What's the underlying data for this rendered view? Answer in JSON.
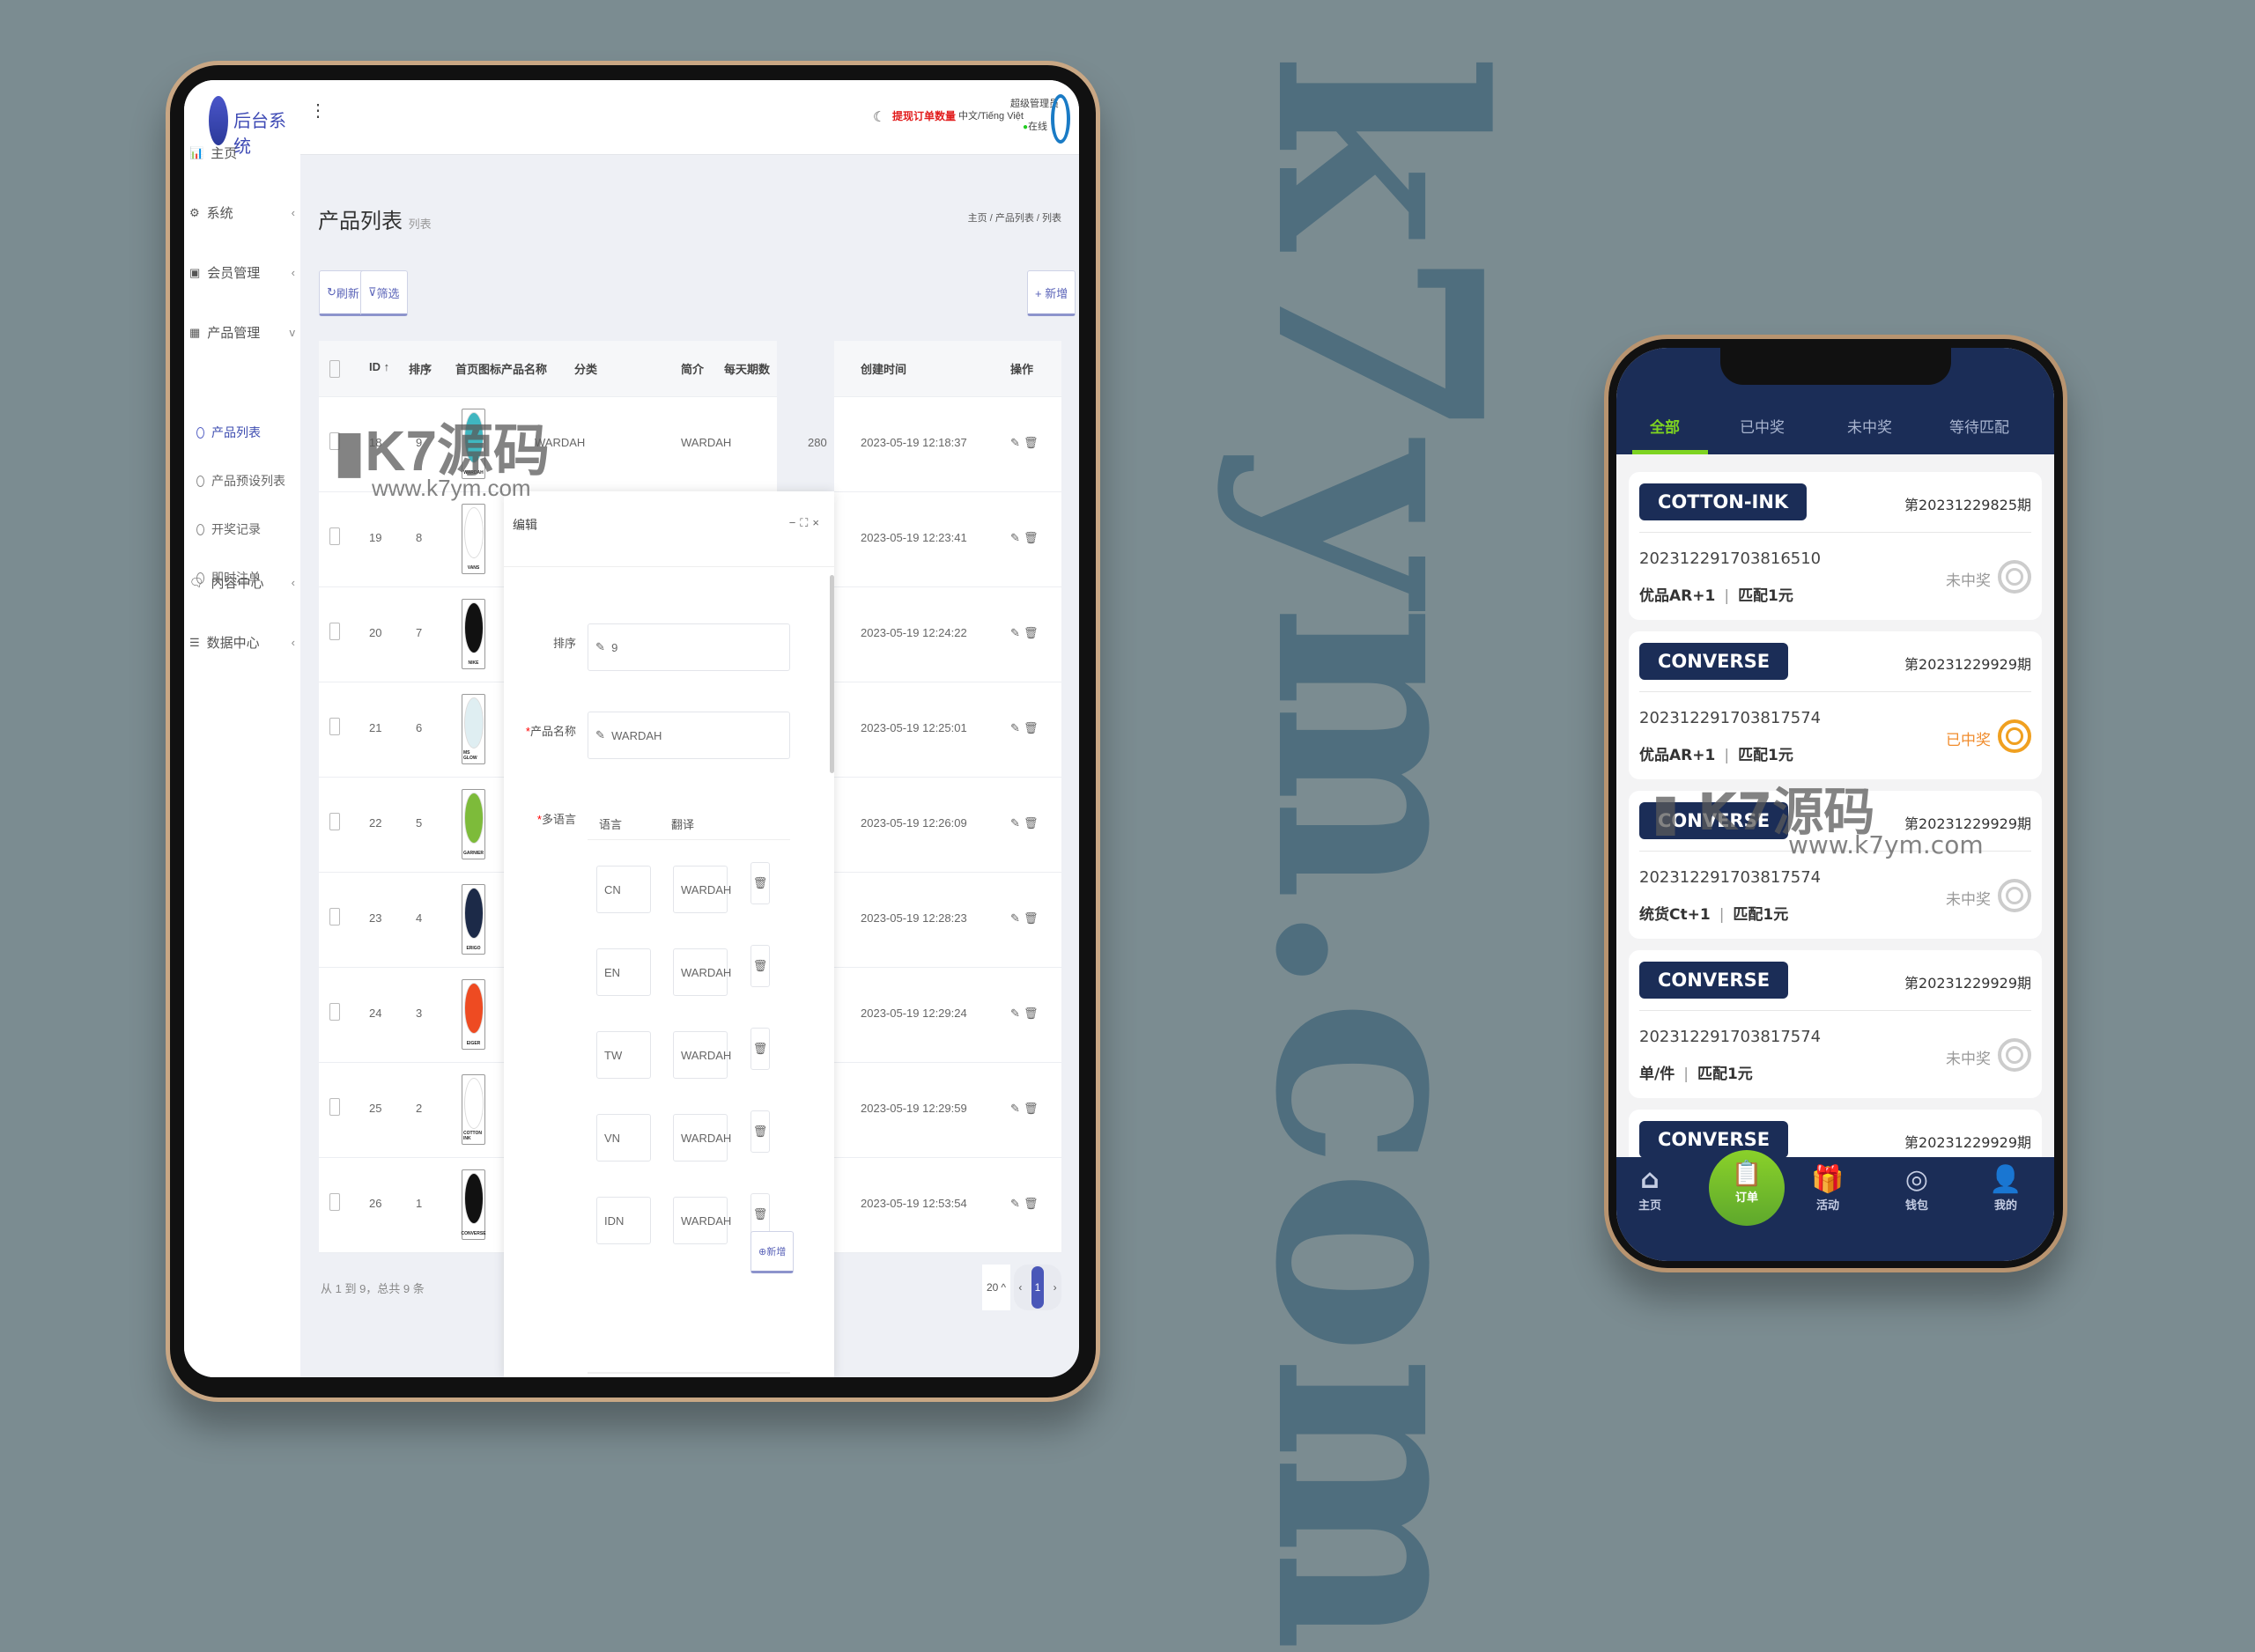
{
  "watermark_domain": "k7ym.com",
  "watermark": {
    "brand": "K7源码",
    "url": "www.k7ym.com"
  },
  "admin": {
    "app_title": "后台系统",
    "header": {
      "order_alert": "提现订单数量",
      "language": "中文/Tiếng Việt",
      "user_role": "超级管理员",
      "user_status": "在线"
    },
    "sidebar": [
      {
        "label": "主页",
        "icon": "chart-icon"
      },
      {
        "label": "系统",
        "icon": "gear-icon",
        "chevron": "‹"
      },
      {
        "label": "会员管理",
        "icon": "id-card-icon",
        "chevron": "‹"
      },
      {
        "label": "产品管理",
        "icon": "grid-icon",
        "chevron": "v"
      },
      {
        "label": "内容中心",
        "icon": "chat-icon",
        "chevron": "‹"
      },
      {
        "label": "数据中心",
        "icon": "database-icon",
        "chevron": "‹"
      }
    ],
    "submenu": [
      "产品列表",
      "产品预设列表",
      "开奖记录",
      "即时注单"
    ],
    "page_title": "产品列表",
    "page_subtitle": "列表",
    "breadcrumb": [
      "主页",
      "产品列表",
      "列表"
    ],
    "toolbar": {
      "refresh": "刷新",
      "filter": "筛选",
      "add": "+ 新增"
    },
    "columns": [
      "ID ↑",
      "排序",
      "首页图标",
      "产品名称",
      "分类",
      "简介",
      "每天期数",
      "创建时间",
      "操作"
    ],
    "rows": [
      {
        "id": "18",
        "sort": "9",
        "logo": "WARDAH",
        "logo_color": "#3fb6c0",
        "name": "WARDAH",
        "intro": "WARDAH",
        "daily": "280",
        "created": "2023-05-19 12:18:37"
      },
      {
        "id": "19",
        "sort": "8",
        "logo": "VANS",
        "logo_color": "#ffffff",
        "created": "2023-05-19 12:23:41"
      },
      {
        "id": "20",
        "sort": "7",
        "logo": "NIKE",
        "logo_color": "#111111",
        "created": "2023-05-19 12:24:22"
      },
      {
        "id": "21",
        "sort": "6",
        "logo": "MS GLOW",
        "logo_color": "#dfeef2",
        "created": "2023-05-19 12:25:01"
      },
      {
        "id": "22",
        "sort": "5",
        "logo": "GARNIER",
        "logo_color": "#7dbb3a",
        "created": "2023-05-19 12:26:09"
      },
      {
        "id": "23",
        "sort": "4",
        "logo": "ERIGO",
        "logo_color": "#1c2a48",
        "created": "2023-05-19 12:28:23"
      },
      {
        "id": "24",
        "sort": "3",
        "logo": "EIGER",
        "logo_color": "#ee4b22",
        "created": "2023-05-19 12:29:24"
      },
      {
        "id": "25",
        "sort": "2",
        "logo": "COTTON INK",
        "logo_color": "#ffffff",
        "created": "2023-05-19 12:29:59"
      },
      {
        "id": "26",
        "sort": "1",
        "logo": "CONVERSE",
        "logo_color": "#111111",
        "created": "2023-05-19 12:53:54"
      }
    ],
    "footer": {
      "summary": "从 1 到 9，总共 9 条",
      "page_size": "20",
      "current_page": "1"
    },
    "modal": {
      "title": "编辑",
      "sort_label": "排序",
      "sort_value": "9",
      "name_label": "产品名称",
      "name_value": "WARDAH",
      "multilang_label": "多语言",
      "lang_col": "语言",
      "trans_col": "翻译",
      "langs": [
        {
          "code": "CN",
          "text": "WARDAH"
        },
        {
          "code": "EN",
          "text": "WARDAH"
        },
        {
          "code": "TW",
          "text": "WARDAH"
        },
        {
          "code": "VN",
          "text": "WARDAH"
        },
        {
          "code": "IDN",
          "text": "WARDAH"
        }
      ],
      "add_row": "新增"
    }
  },
  "mobile": {
    "tabs": [
      "全部",
      "已中奖",
      "未中奖",
      "等待匹配"
    ],
    "active_tab": 0,
    "orders": [
      {
        "brand": "COTTON-INK",
        "period": "第20231229825期",
        "order_no": "202312291703816510",
        "spec": "优品AR+1",
        "match": "匹配1元",
        "status": "未中奖",
        "won": false
      },
      {
        "brand": "CONVERSE",
        "period": "第20231229929期",
        "order_no": "202312291703817574",
        "spec": "优品AR+1",
        "match": "匹配1元",
        "status": "已中奖",
        "won": true
      },
      {
        "brand": "CONVERSE",
        "period": "第20231229929期",
        "order_no": "202312291703817574",
        "spec": "统货Ct+1",
        "match": "匹配1元",
        "status": "未中奖",
        "won": false
      },
      {
        "brand": "CONVERSE",
        "period": "第20231229929期",
        "order_no": "202312291703817574",
        "spec": "单/件",
        "match": "匹配1元",
        "status": "未中奖",
        "won": false
      },
      {
        "brand": "CONVERSE",
        "period": "第20231229929期"
      }
    ],
    "nav": [
      {
        "label": "主页",
        "icon": "home-icon"
      },
      {
        "label": "订单",
        "icon": "order-icon"
      },
      {
        "label": "活动",
        "icon": "gift-icon"
      },
      {
        "label": "钱包",
        "icon": "wallet-icon"
      },
      {
        "label": "我的",
        "icon": "user-icon"
      }
    ],
    "colors": {
      "navy": "#1b2d57",
      "green": "#7ed321",
      "won": "#f08c2d"
    }
  }
}
